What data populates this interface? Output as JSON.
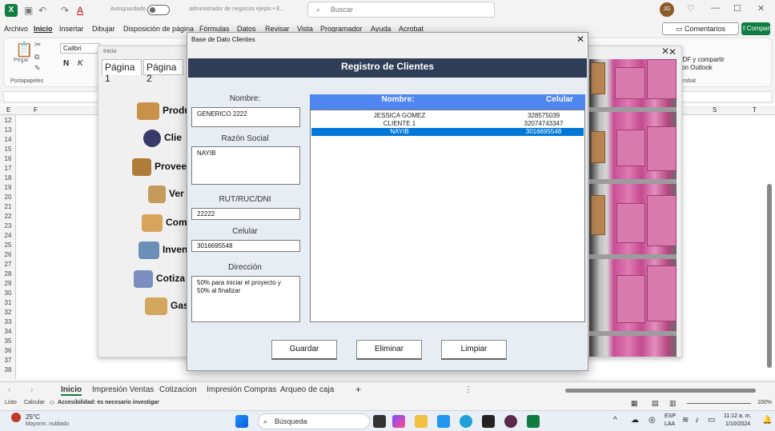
{
  "titlebar": {
    "autosave_label": "Autoguardado",
    "doc_title": "administrador de negocios ejeplo • E...",
    "search_placeholder": "Buscar",
    "user_initials": "JG"
  },
  "ribbon": {
    "tabs": [
      "Archivo",
      "Inicio",
      "Insertar",
      "Dibujar",
      "Disposición de página",
      "Fórmulas",
      "Datos",
      "Revisar",
      "Vista",
      "Programador",
      "Ayuda",
      "Acrobat"
    ],
    "comentarios_label": "Comentarios",
    "compartir_label": "Compartir",
    "font_name": "Calibri",
    "paste_label": "Pegar",
    "portapapeles_label": "Portapapeles",
    "bold": "N",
    "italic": "K",
    "pdf_label": "PDF y compartir con Outlook",
    "acrobat_group": "Acrobat"
  },
  "sheet": {
    "rows": [
      "12",
      "13",
      "14",
      "15",
      "16",
      "17",
      "18",
      "19",
      "20",
      "21",
      "22",
      "23",
      "24",
      "25",
      "26",
      "27",
      "28",
      "29",
      "30",
      "31",
      "32",
      "33",
      "34",
      "35",
      "36",
      "37",
      "38"
    ],
    "cols": [
      "E",
      "F",
      "S",
      "T"
    ]
  },
  "inicio_form": {
    "title": "Inicio",
    "pages": [
      "Página 1",
      "Página 2"
    ],
    "items": [
      "Produ",
      "Clie",
      "Provee",
      "Ver",
      "Com",
      "Inven",
      "Cotiza",
      "Gas"
    ]
  },
  "dialog": {
    "title": "Base de Dato Clientes",
    "close": "✕",
    "banner": "Registro de Clientes",
    "labels": {
      "nombre": "Nombre:",
      "razon": "Razón Social",
      "rut": "RUT/RUC/DNI",
      "celular": "Celular",
      "direccion": "Dirección"
    },
    "values": {
      "nombre": "GENERICO 2222",
      "razon": "NAYIB",
      "rut": "22222",
      "celular": "3016695548",
      "direccion": "50% para iniciar el proyecto y\n50% al finalizar"
    },
    "list_headers": {
      "nombre": "Nombre:",
      "celular": "Celular"
    },
    "list_rows": [
      {
        "nombre": "JESSICA GOMEZ",
        "celular": "328575039"
      },
      {
        "nombre": "CLIENTE 1",
        "celular": "32074743347"
      },
      {
        "nombre": "NAYIB",
        "celular": "3016695548"
      }
    ],
    "buttons": {
      "guardar": "Guardar",
      "eliminar": "Eliminar",
      "limpiar": "Limpiar"
    }
  },
  "sheet_tabs": [
    "Inicio",
    "Impresión Ventas",
    "Cotizacion",
    "Impresión Compras",
    "Arqueo de caja"
  ],
  "statusbar": {
    "listo": "Listo",
    "calcular": "Calcular",
    "accesibilidad": "Accesibilidad: es necesario investigar",
    "zoom": "100%"
  },
  "taskbar": {
    "weather_temp": "25°C",
    "weather_desc": "Mayorm. nublado",
    "search": "Búsqueda",
    "lang1": "ESP",
    "lang2": "LAA",
    "time": "11:12 a. m.",
    "date": "1/10/2024"
  },
  "colors": {
    "excel_green": "#107c41",
    "banner": "#2f3d57",
    "list_header": "#4f86f0",
    "selection": "#0078d7"
  }
}
